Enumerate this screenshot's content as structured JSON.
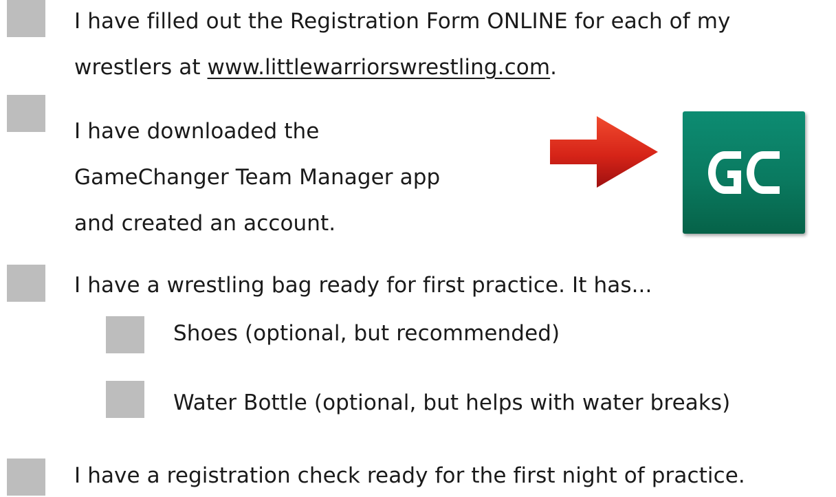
{
  "items": [
    {
      "lines": [
        "I have filled out the Registration Form ONLINE for each of my"
      ],
      "line2_before": "wrestlers at ",
      "link_text": "www.littlewarriorswrestling.com",
      "line2_after": "."
    },
    {
      "lines": [
        "I have downloaded the",
        "GameChanger Team Manager app",
        "and created an account."
      ]
    },
    {
      "lines": [
        "I have a wrestling bag ready for first practice. It has..."
      ]
    },
    {
      "lines": [
        "I have a registration check ready for the first night of practice."
      ]
    }
  ],
  "subitems": [
    {
      "label": "Shoes (optional, but recommended)"
    },
    {
      "label": "Water Bottle (optional, but helps with water breaks)"
    }
  ],
  "app_icon": {
    "name": "gamechanger-icon",
    "letters": "GC",
    "color": "#0a7a60"
  },
  "arrow": {
    "name": "red-arrow-icon",
    "color": "#d62418"
  }
}
